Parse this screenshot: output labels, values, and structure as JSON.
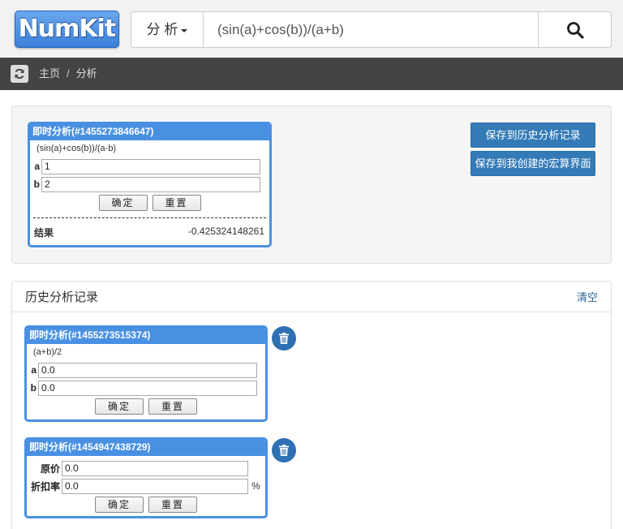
{
  "header": {
    "logo_text": "NumKit",
    "search_mode": "分 析",
    "search_value": "(sin(a)+cos(b))/(a+b)"
  },
  "breadcrumb": {
    "home": "主页",
    "separator": "/",
    "current": "分析"
  },
  "current_widget": {
    "title": "即时分析(#1455273846647)",
    "expression": "(sin(a)+cos(b))/(a-b)",
    "fields": [
      {
        "label": "a",
        "value": "1"
      },
      {
        "label": "b",
        "value": "2"
      }
    ],
    "confirm_label": "确定",
    "reset_label": "重置",
    "result_label": "结果",
    "result_value": "-0.425324148261"
  },
  "actions": {
    "save_history": "保存到历史分析记录",
    "save_macro": "保存到我创建的宏算界面"
  },
  "history": {
    "title": "历史分析记录",
    "clear_label": "清空",
    "items": [
      {
        "title": "即时分析(#1455273515374)",
        "expression": "(a+b)/2",
        "fields": [
          {
            "label": "a",
            "value": "0.0"
          },
          {
            "label": "b",
            "value": "0.0"
          }
        ],
        "confirm_label": "确定",
        "reset_label": "重置"
      },
      {
        "title": "即时分析(#1454947438729)",
        "fields": [
          {
            "label": "原价",
            "value": "0.0",
            "unit": ""
          },
          {
            "label": "折扣率",
            "value": "0.0",
            "unit": "%"
          }
        ],
        "confirm_label": "确定",
        "reset_label": "重置"
      }
    ]
  },
  "colors": {
    "accent": "#4a90e2",
    "button_blue": "#337ab7",
    "breadcrumb_bg": "#444444"
  },
  "icons": {
    "search": "search-icon",
    "refresh": "refresh-icon",
    "trash": "trash-icon"
  }
}
